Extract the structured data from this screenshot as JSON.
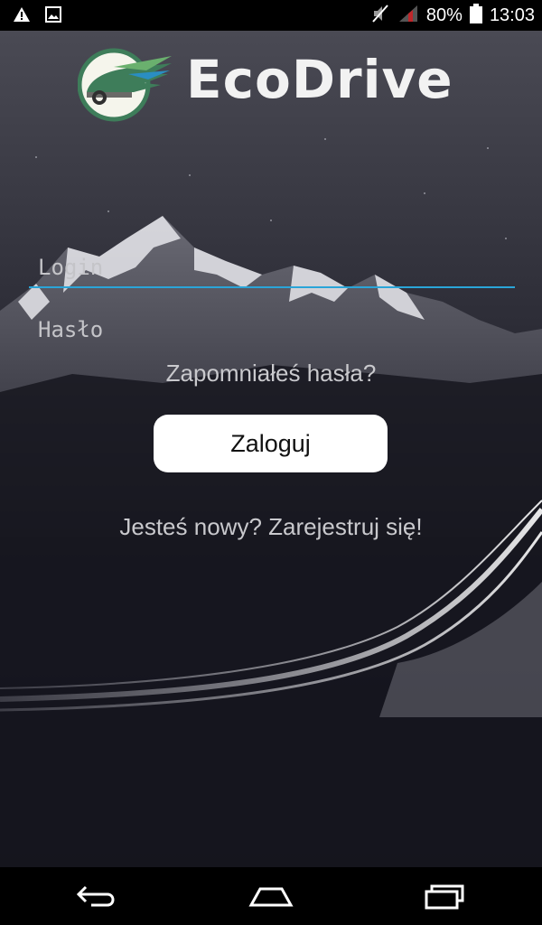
{
  "status_bar": {
    "battery_percent": "80%",
    "time": "13:03",
    "icons": [
      "warning-icon",
      "image-icon",
      "mute-icon",
      "signal-icon",
      "battery-icon"
    ]
  },
  "app": {
    "name": "EcoDrive",
    "colors": {
      "accent": "#2aa5d8",
      "logo_green": "#3e7d5a",
      "button_bg": "#ffffff"
    }
  },
  "form": {
    "login_placeholder": "Login",
    "password_placeholder": "Hasło",
    "forgot_label": "Zapomniałeś hasła?",
    "submit_label": "Zaloguj",
    "register_label": "Jesteś nowy? Zarejestruj się!"
  },
  "nav_bar": {
    "icons": [
      "back-icon",
      "home-icon",
      "recent-apps-icon"
    ]
  }
}
